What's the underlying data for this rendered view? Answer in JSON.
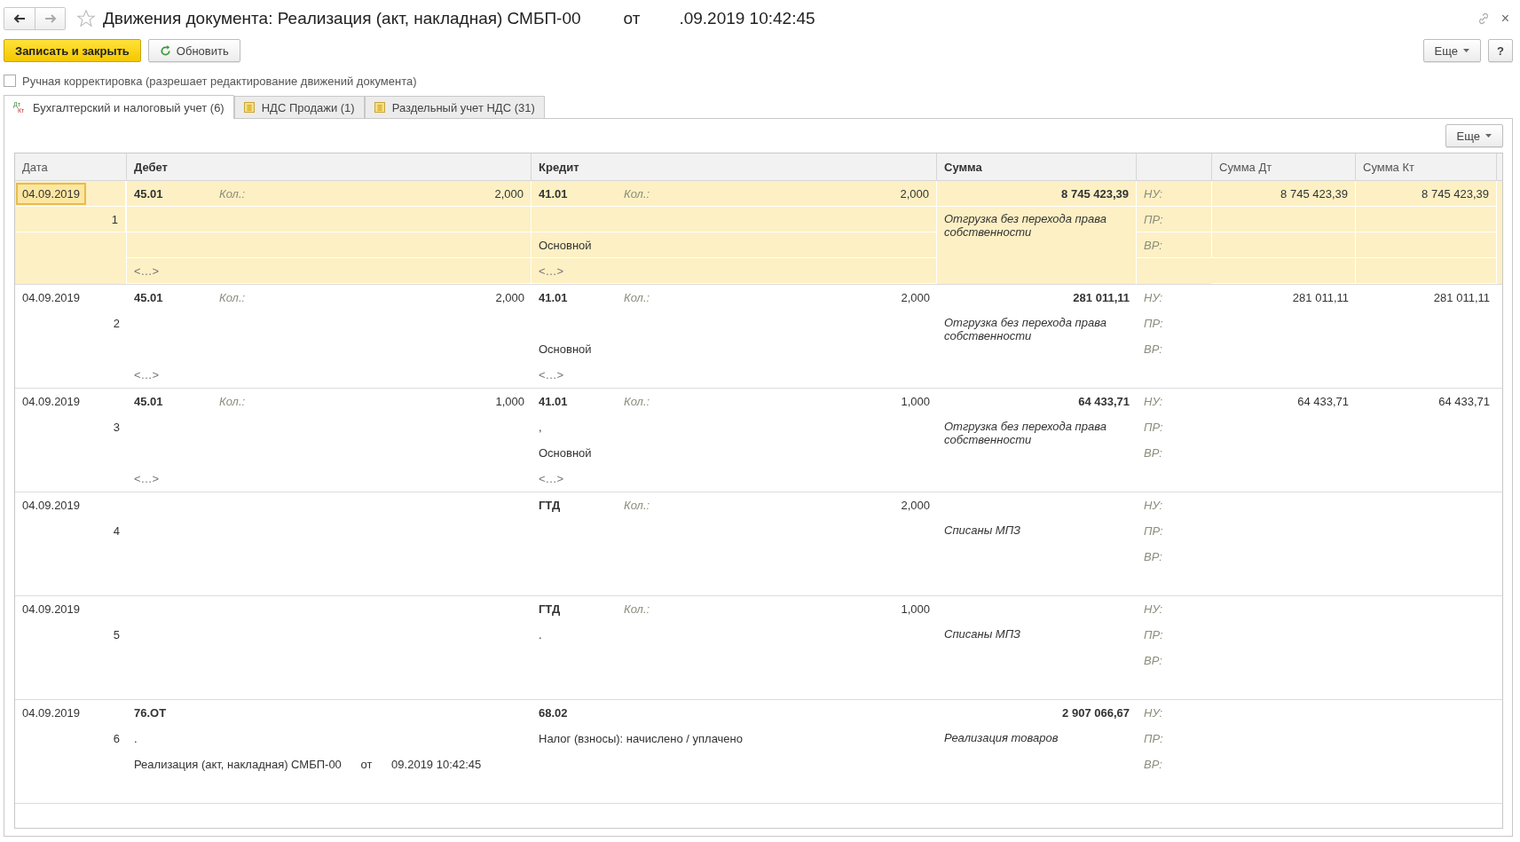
{
  "window": {
    "title": "Движения документа: Реализация (акт, накладная) СМБП-00",
    "title_from": "от",
    "title_date": ".09.2019 10:42:45",
    "close": "×"
  },
  "toolbar": {
    "primary_button": "Записать и закрыть",
    "refresh_button": "Обновить",
    "more_button": "Еще",
    "help_button": "?"
  },
  "manual_edit": {
    "label": "Ручная корректировка (разрешает редактирование движений документа)",
    "checked": false
  },
  "tabs": [
    {
      "label": "Бухгалтерский и налоговый учет (6)",
      "selected": true,
      "kind": "accounting",
      "icon_top": "Дт",
      "icon_bottom": "Кт"
    },
    {
      "label": "НДС Продажи (1)",
      "selected": false,
      "kind": "register"
    },
    {
      "label": "Раздельный учет НДС (31)",
      "selected": false,
      "kind": "register"
    }
  ],
  "table": {
    "more_button": "Еще",
    "columns": [
      "Дата",
      "Дебет",
      "Кредит",
      "Сумма",
      "Сумма Дт",
      "Сумма Кт"
    ],
    "rows": [
      {
        "date": "04.09.2019",
        "number": "1",
        "selected": true,
        "debit": {
          "account": "45.01",
          "qty_label": "Кол.:",
          "qty": "2,000",
          "sub3": "<…>"
        },
        "credit": {
          "account": "41.01",
          "qty_label": "Кол.:",
          "qty": "2,000",
          "sub2": "Основной",
          "sub3": "<…>"
        },
        "sum": "8 745 423,39",
        "content": "Отгрузка без перехода права собственности",
        "tax_labels": [
          "НУ:",
          "ПР:",
          "ВР:"
        ],
        "sum_dt": "8 745 423,39",
        "sum_kt": "8 745 423,39"
      },
      {
        "date": "04.09.2019",
        "number": "2",
        "selected": false,
        "debit": {
          "account": "45.01",
          "qty_label": "Кол.:",
          "qty": "2,000",
          "sub3": "<…>"
        },
        "credit": {
          "account": "41.01",
          "qty_label": "Кол.:",
          "qty": "2,000",
          "sub2": "Основной",
          "sub3": "<…>"
        },
        "sum": "281 011,11",
        "content": "Отгрузка без перехода права собственности",
        "tax_labels": [
          "НУ:",
          "ПР:",
          "ВР:"
        ],
        "sum_dt": "281 011,11",
        "sum_kt": "281 011,11"
      },
      {
        "date": "04.09.2019",
        "number": "3",
        "selected": false,
        "debit": {
          "account": "45.01",
          "qty_label": "Кол.:",
          "qty": "1,000",
          "sub3": "<…>"
        },
        "credit": {
          "account": "41.01",
          "qty_label": "Кол.:",
          "qty": "1,000",
          "sub1": ",",
          "sub2": "Основной",
          "sub3": "<…>"
        },
        "sum": "64 433,71",
        "content": "Отгрузка без перехода права собственности",
        "tax_labels": [
          "НУ:",
          "ПР:",
          "ВР:"
        ],
        "sum_dt": "64 433,71",
        "sum_kt": "64 433,71"
      },
      {
        "date": "04.09.2019",
        "number": "4",
        "selected": false,
        "credit": {
          "account": "ГТД",
          "qty_label": "Кол.:",
          "qty": "2,000"
        },
        "content": "Списаны МПЗ",
        "tax_labels": [
          "НУ:",
          "ПР:",
          "ВР:"
        ]
      },
      {
        "date": "04.09.2019",
        "number": "5",
        "selected": false,
        "credit": {
          "account": "ГТД",
          "qty_label": "Кол.:",
          "qty": "1,000",
          "sub1": "."
        },
        "content": "Списаны МПЗ",
        "tax_labels": [
          "НУ:",
          "ПР:",
          "ВР:"
        ]
      },
      {
        "date": "04.09.2019",
        "number": "6",
        "selected": false,
        "debit": {
          "account": "76.ОТ",
          "sub1": ".",
          "sub2": "Реализация (акт, накладная) СМБП-00      от      09.2019 10:42:45"
        },
        "credit": {
          "account": "68.02",
          "sub1": "Налог (взносы): начислено / уплачено"
        },
        "sum": "2 907 066,67",
        "content": "Реализация товаров",
        "tax_labels": [
          "НУ:",
          "ПР:",
          "ВР:"
        ]
      }
    ]
  }
}
